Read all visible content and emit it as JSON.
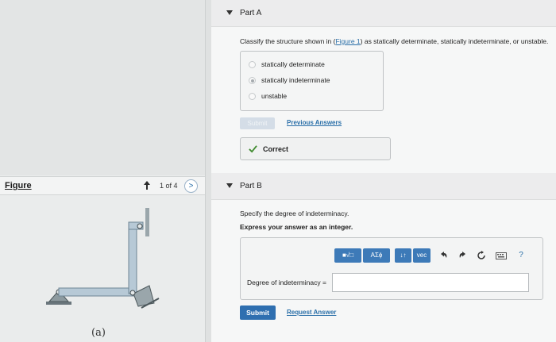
{
  "figure_panel": {
    "title": "Figure",
    "count": "1 of 4",
    "next_symbol": ">",
    "caption": "(a)"
  },
  "partA": {
    "label": "Part A",
    "question_pre": "Classify the structure shown in (",
    "question_link": "Figure 1",
    "question_post": ") as statically determinate, statically indeterminate, or unstable.",
    "options": [
      {
        "label": "statically determinate",
        "selected": false
      },
      {
        "label": "statically indeterminate",
        "selected": true
      },
      {
        "label": "unstable",
        "selected": false
      }
    ],
    "submit_label": "Submit",
    "previous_answers": "Previous Answers",
    "result": "Correct"
  },
  "partB": {
    "label": "Part B",
    "question": "Specify the degree of indeterminacy.",
    "instruction": "Express your answer as an integer.",
    "toolbar": {
      "template": "■√□",
      "greek": "AΣϕ",
      "arrows": "↓↑",
      "vec": "vec",
      "help": "?"
    },
    "field_label": "Degree of indeterminacy =",
    "field_value": "",
    "submit_label": "Submit",
    "request_answer": "Request Answer"
  }
}
